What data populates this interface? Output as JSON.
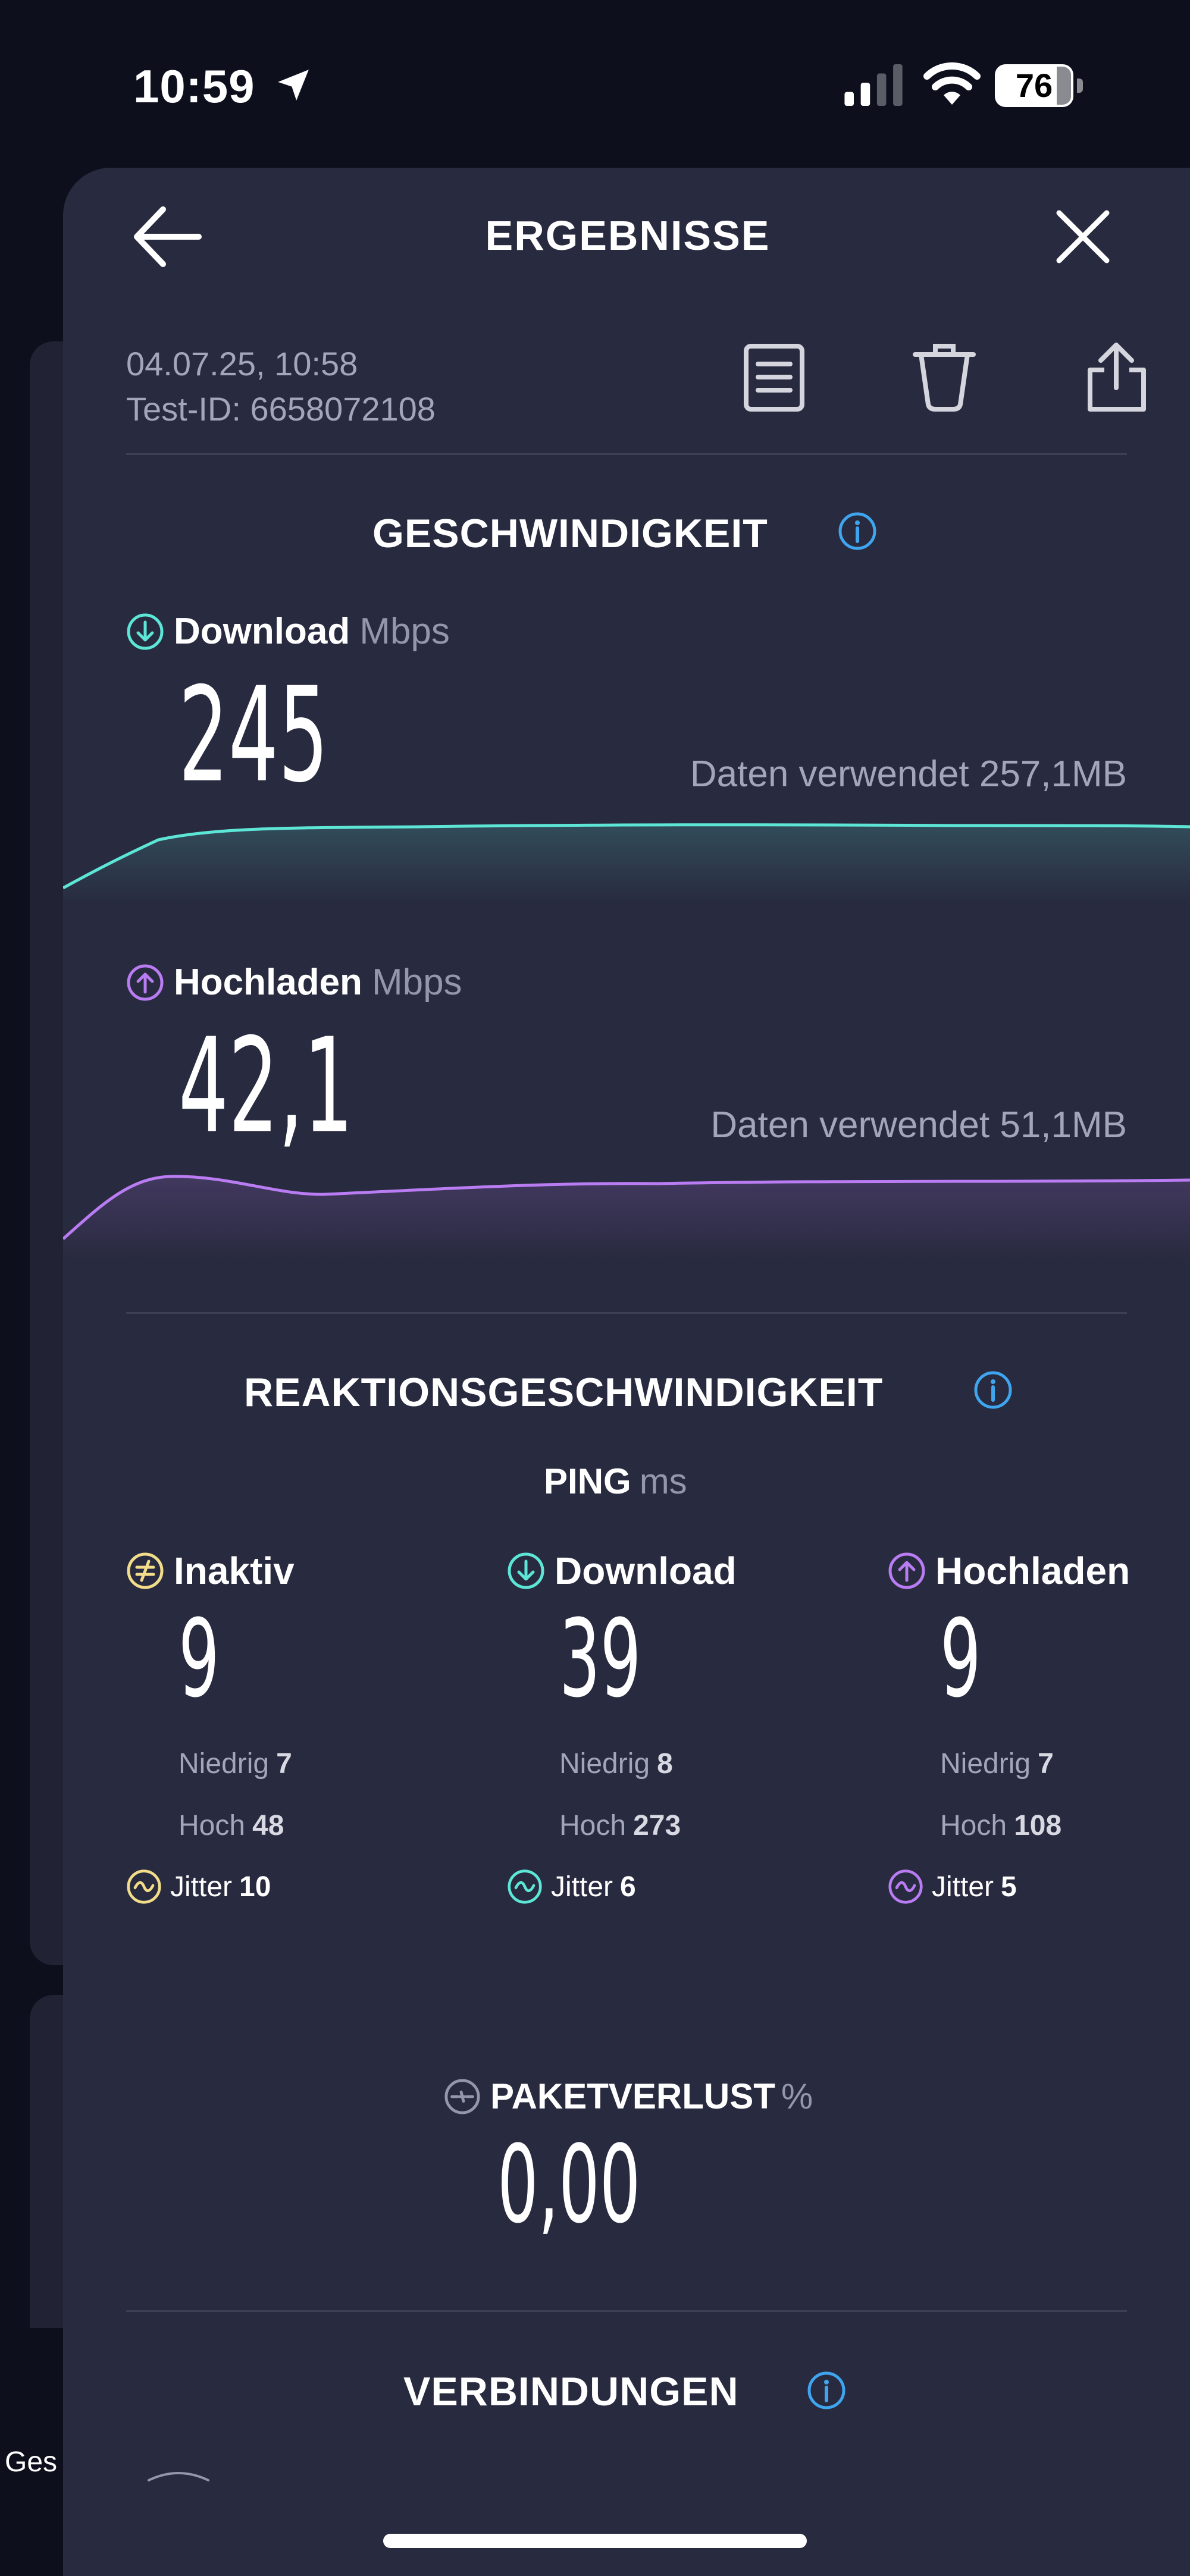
{
  "status_bar": {
    "time": "10:59",
    "battery": "76"
  },
  "background": {
    "partial_label": "Ges"
  },
  "header": {
    "title": "ERGEBNISSE"
  },
  "meta": {
    "date": "04.07.25, 10:58",
    "test_id": "Test-ID: 6658072108"
  },
  "speed": {
    "title": "GESCHWINDIGKEIT",
    "download": {
      "label": "Download",
      "unit": "Mbps",
      "value": "245",
      "data_used": "Daten verwendet 257,1MB"
    },
    "upload": {
      "label": "Hochladen",
      "unit": "Mbps",
      "value": "42,1",
      "data_used": "Daten verwendet 51,1MB"
    }
  },
  "responsiveness": {
    "title": "REAKTIONSGESCHWINDIGKEIT",
    "ping_label": "PING",
    "ping_unit": "ms",
    "columns": [
      {
        "label": "Inaktiv",
        "value": "9",
        "low_label": "Niedrig",
        "low": "7",
        "high_label": "Hoch",
        "high": "48",
        "jitter_label": "Jitter",
        "jitter": "10"
      },
      {
        "label": "Download",
        "value": "39",
        "low_label": "Niedrig",
        "low": "8",
        "high_label": "Hoch",
        "high": "273",
        "jitter_label": "Jitter",
        "jitter": "6"
      },
      {
        "label": "Hochladen",
        "value": "9",
        "low_label": "Niedrig",
        "low": "7",
        "high_label": "Hoch",
        "high": "108",
        "jitter_label": "Jitter",
        "jitter": "5"
      }
    ]
  },
  "packet_loss": {
    "label": "PAKETVERLUST",
    "unit": "%",
    "value": "0,00"
  },
  "connections": {
    "title": "VERBINDUNGEN"
  },
  "colors": {
    "download": "#5de6d6",
    "upload": "#b97cf2",
    "idle": "#f2dd8a",
    "info": "#3fa5ee",
    "background": "#282a3f"
  }
}
